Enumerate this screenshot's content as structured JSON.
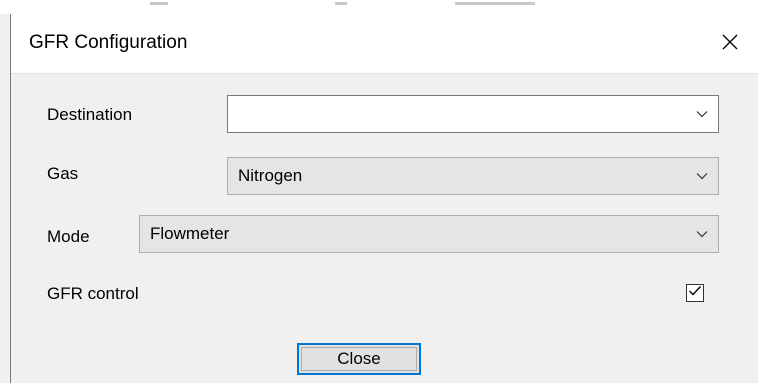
{
  "dialog": {
    "title": "GFR Configuration"
  },
  "form": {
    "destination": {
      "label": "Destination",
      "value": ""
    },
    "gas": {
      "label": "Gas",
      "value": "Nitrogen"
    },
    "mode": {
      "label": "Mode",
      "value": "Flowmeter"
    },
    "gfr_control": {
      "label": "GFR control",
      "checked": true
    }
  },
  "buttons": {
    "close_label": "Close"
  },
  "icons": {
    "close": "close-icon",
    "dropdown": "chevron-down-icon",
    "check": "checkmark-icon"
  },
  "colors": {
    "accent": "#0078d7"
  }
}
